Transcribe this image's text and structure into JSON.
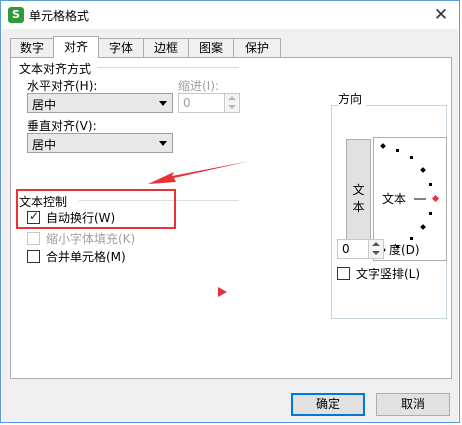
{
  "window": {
    "title": "单元格格式",
    "app_icon": "S",
    "close": "✕"
  },
  "tabs": [
    {
      "label": "数字",
      "active": false
    },
    {
      "label": "对齐",
      "active": true
    },
    {
      "label": "字体",
      "active": false
    },
    {
      "label": "边框",
      "active": false
    },
    {
      "label": "图案",
      "active": false
    },
    {
      "label": "保护",
      "active": false
    }
  ],
  "alignment": {
    "group_title": "文本对齐方式",
    "horizontal_label": "水平对齐(H):",
    "horizontal_value": "居中",
    "indent_label": "缩进(I):",
    "indent_value": "0",
    "vertical_label": "垂直对齐(V):",
    "vertical_value": "居中"
  },
  "text_control": {
    "group_title": "文本控制",
    "wrap_text": {
      "label": "自动换行(W)",
      "checked": true
    },
    "shrink_to_fit": {
      "label": "缩小字体填充(K)",
      "checked": false,
      "disabled": true
    },
    "merge_cells": {
      "label": "合并单元格(M)",
      "checked": false
    }
  },
  "orientation": {
    "group_title": "方向",
    "vertical_text": "文本",
    "dial_text": "文本",
    "degrees_value": "0",
    "degrees_label": "度(D)",
    "vertical_stack": {
      "label": "文字竖排(L)",
      "checked": false
    }
  },
  "buttons": {
    "ok": "确定",
    "cancel": "取消"
  },
  "annotation": {
    "color": "#e8323a"
  }
}
